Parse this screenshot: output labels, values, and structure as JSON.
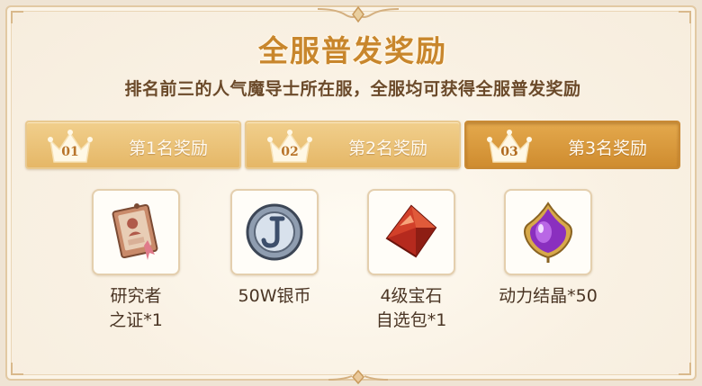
{
  "header": {
    "title": "全服普发奖励",
    "subtitle": "排名前三的人气魔导士所在服，全服均可获得全服普发奖励"
  },
  "tabs": [
    {
      "number": "01",
      "label": "第1名奖励",
      "active": false
    },
    {
      "number": "02",
      "label": "第2名奖励",
      "active": false
    },
    {
      "number": "03",
      "label": "第3名奖励",
      "active": true
    }
  ],
  "rewards": [
    {
      "name_line1": "研究者",
      "name_line2": "之证*1",
      "icon": "researcher-badge-icon"
    },
    {
      "name_line1": "50W银币",
      "name_line2": "",
      "icon": "silver-coin-icon"
    },
    {
      "name_line1": "4级宝石",
      "name_line2": "自选包*1",
      "icon": "red-gem-icon"
    },
    {
      "name_line1": "动力结晶*50",
      "name_line2": "",
      "icon": "purple-crystal-icon"
    }
  ],
  "colors": {
    "title": "#c8862c",
    "tab_inactive": "#e5b767",
    "tab_active": "#cf8c2f",
    "text_dark": "#4a3524"
  }
}
